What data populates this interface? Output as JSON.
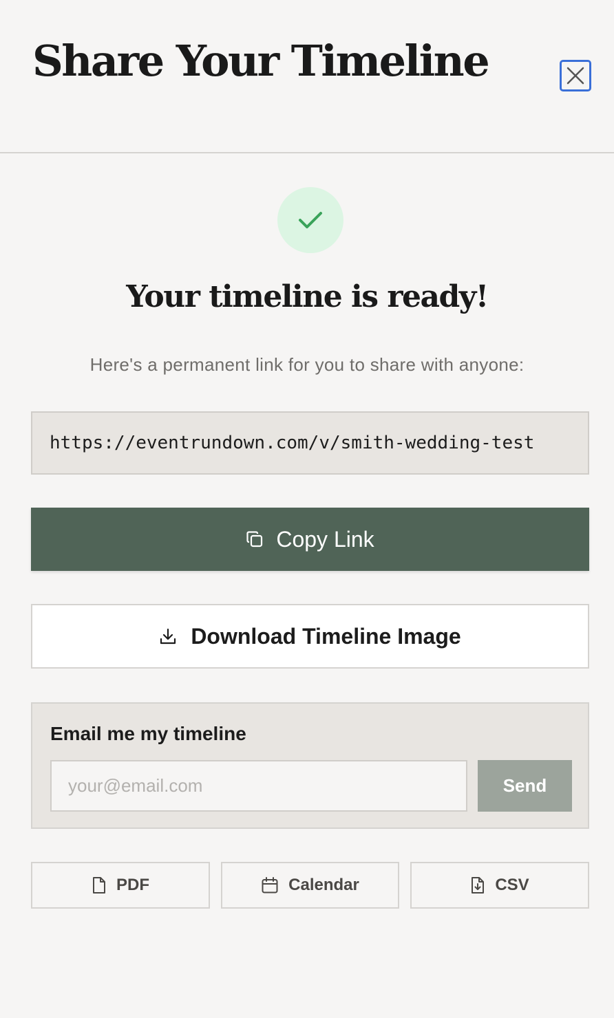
{
  "header": {
    "title": "Share Your Timeline",
    "close_icon": "close-icon"
  },
  "status": {
    "icon": "check-icon",
    "heading": "Your timeline is ready!",
    "subtitle": "Here's a permanent link for you to share with anyone:"
  },
  "share_link": {
    "url": "https://eventrundown.com/v/smith-wedding-test"
  },
  "actions": {
    "copy_label": "Copy Link",
    "copy_icon": "copy-icon",
    "download_label": "Download Timeline Image",
    "download_icon": "download-icon"
  },
  "email": {
    "label": "Email me my timeline",
    "placeholder": "your@email.com",
    "value": "",
    "send_label": "Send"
  },
  "exports": [
    {
      "label": "PDF",
      "icon": "file-icon"
    },
    {
      "label": "Calendar",
      "icon": "calendar-icon"
    },
    {
      "label": "CSV",
      "icon": "file-download-icon"
    }
  ],
  "colors": {
    "background": "#f6f5f4",
    "primary_button": "#506457",
    "success_bg": "#dcf5e3",
    "success_check": "#3aa35a",
    "focus_ring": "#3a6fd8",
    "send_disabled": "#9ca49c"
  }
}
